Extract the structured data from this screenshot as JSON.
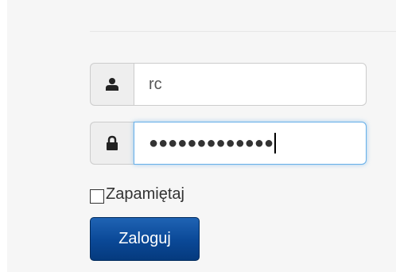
{
  "login_form": {
    "username": {
      "icon": "user-icon",
      "value": "rc"
    },
    "password": {
      "icon": "lock-icon",
      "masked_value": "●●●●●●●●●●●●●"
    },
    "remember_me": {
      "label": "Zapamiętaj",
      "checked": false
    },
    "submit_label": "Zaloguj"
  },
  "colors": {
    "button_primary": "#0a4896",
    "focus_border": "#66afe9"
  }
}
